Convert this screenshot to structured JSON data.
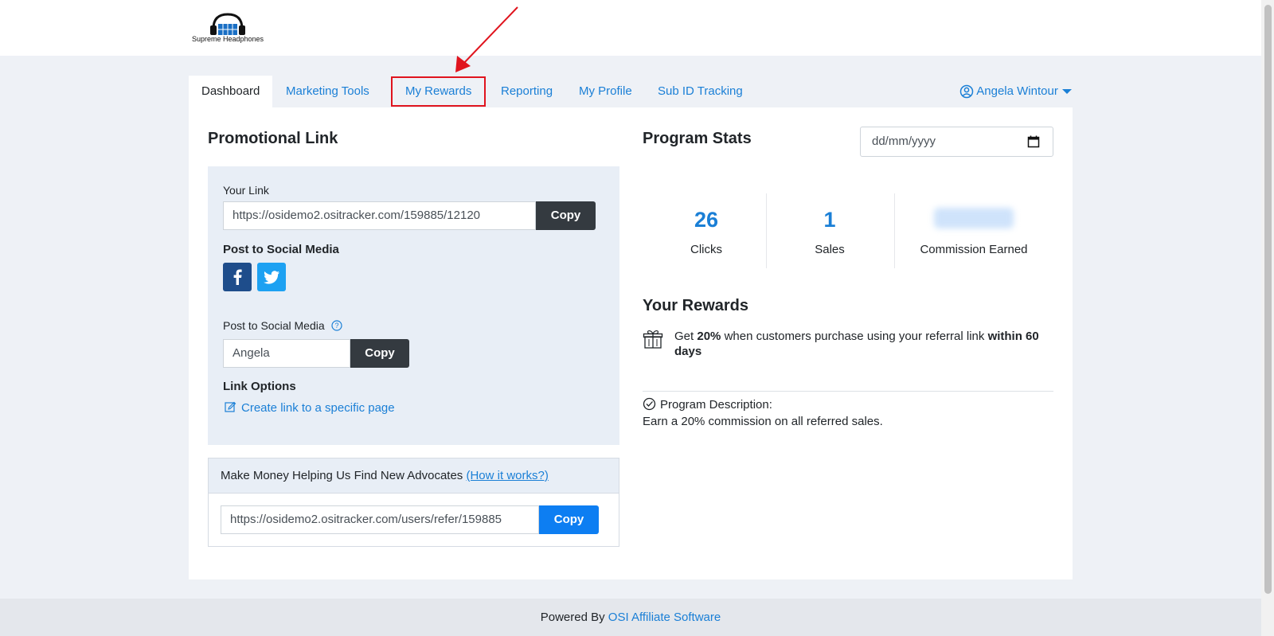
{
  "brand": {
    "name": "Supreme Headphones"
  },
  "nav": {
    "tabs": [
      {
        "label": "Dashboard"
      },
      {
        "label": "Marketing Tools"
      },
      {
        "label": "My Rewards"
      },
      {
        "label": "Reporting"
      },
      {
        "label": "My Profile"
      },
      {
        "label": "Sub ID Tracking"
      }
    ],
    "user_name": "Angela Wintour"
  },
  "promo": {
    "title": "Promotional Link",
    "your_link_label": "Your Link",
    "your_link_value": "https://osidemo2.ositracker.com/159885/12120",
    "copy_label": "Copy",
    "social_heading": "Post to Social Media",
    "social_field_label": "Post to Social Media",
    "social_field_value": "Angela",
    "social_copy_label": "Copy",
    "link_options_heading": "Link Options",
    "create_link_label": "Create link to a specific page"
  },
  "referral": {
    "heading": "Make Money Helping Us Find New Advocates",
    "how_it_works": "(How it works?)",
    "link_value": "https://osidemo2.ositracker.com/users/refer/159885",
    "copy_label": "Copy"
  },
  "stats": {
    "title": "Program Stats",
    "date_placeholder": "dd/mm/yyyy",
    "items": [
      {
        "value": "26",
        "label": "Clicks"
      },
      {
        "value": "1",
        "label": "Sales"
      },
      {
        "value": "",
        "label": "Commission Earned"
      }
    ]
  },
  "rewards": {
    "title": "Your Rewards",
    "text_get": "Get",
    "text_percent": "20%",
    "text_middle": "when customers purchase using your referral link",
    "text_window": "within 60 days",
    "description_label": "Program Description:",
    "description_text": "Earn a 20% commission on all referred sales."
  },
  "footer": {
    "prefix": "Powered By",
    "link": "OSI Affiliate Software"
  },
  "colors": {
    "accent": "#1a7fd6",
    "highlight_box": "#e0141e",
    "facebook": "#1e4d8b",
    "twitter": "#1da1f2",
    "copy_blue": "#0d7ef2"
  }
}
